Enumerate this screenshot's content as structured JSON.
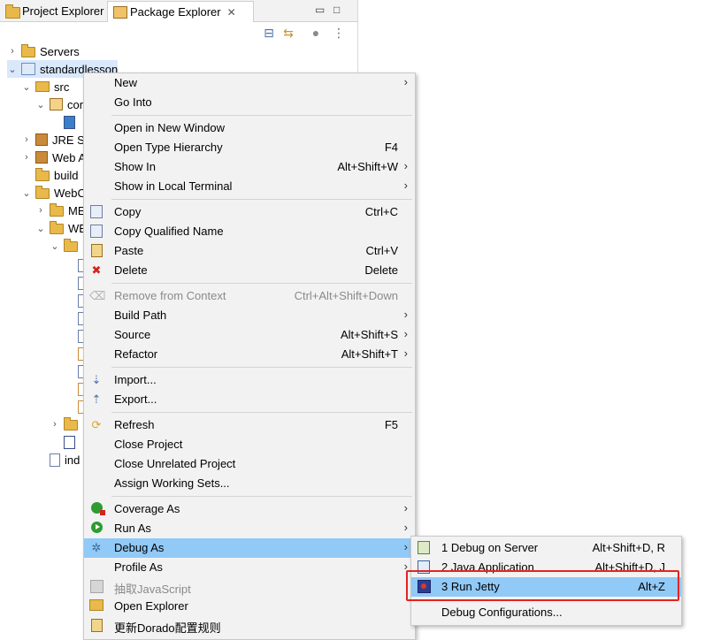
{
  "tabs": {
    "project_explorer": "Project Explorer",
    "package_explorer": "Package Explorer"
  },
  "tree": {
    "servers": "Servers",
    "project": "standardlesson",
    "src": "src",
    "com": "cor",
    "jre": "JRE Sy",
    "webapp": "Web A",
    "build": "build",
    "webcontent": "WebC",
    "meta": "ME",
    "webinf": "WE",
    "index": "ind"
  },
  "menu": {
    "items": [
      {
        "label": "New",
        "key": "",
        "arrow": true
      },
      {
        "label": "Go Into",
        "key": "",
        "arrow": false
      },
      {
        "label": "Open in New Window",
        "key": "",
        "arrow": false
      },
      {
        "label": "Open Type Hierarchy",
        "key": "F4",
        "arrow": false
      },
      {
        "label": "Show In",
        "key": "Alt+Shift+W",
        "arrow": true
      },
      {
        "label": "Show in Local Terminal",
        "key": "",
        "arrow": true
      },
      {
        "label": "Copy",
        "key": "Ctrl+C",
        "arrow": false
      },
      {
        "label": "Copy Qualified Name",
        "key": "",
        "arrow": false
      },
      {
        "label": "Paste",
        "key": "Ctrl+V",
        "arrow": false
      },
      {
        "label": "Delete",
        "key": "Delete",
        "arrow": false
      },
      {
        "label": "Remove from Context",
        "key": "Ctrl+Alt+Shift+Down",
        "arrow": false
      },
      {
        "label": "Build Path",
        "key": "",
        "arrow": true
      },
      {
        "label": "Source",
        "key": "Alt+Shift+S",
        "arrow": true
      },
      {
        "label": "Refactor",
        "key": "Alt+Shift+T",
        "arrow": true
      },
      {
        "label": "Import...",
        "key": "",
        "arrow": false
      },
      {
        "label": "Export...",
        "key": "",
        "arrow": false
      },
      {
        "label": "Refresh",
        "key": "F5",
        "arrow": false
      },
      {
        "label": "Close Project",
        "key": "",
        "arrow": false
      },
      {
        "label": "Close Unrelated Project",
        "key": "",
        "arrow": false
      },
      {
        "label": "Assign Working Sets...",
        "key": "",
        "arrow": false
      },
      {
        "label": "Coverage As",
        "key": "",
        "arrow": true
      },
      {
        "label": "Run As",
        "key": "",
        "arrow": true
      },
      {
        "label": "Debug As",
        "key": "",
        "arrow": true
      },
      {
        "label": "Profile As",
        "key": "",
        "arrow": true
      },
      {
        "label": "抽取JavaScript",
        "key": "",
        "arrow": false
      },
      {
        "label": "Open Explorer",
        "key": "",
        "arrow": false
      },
      {
        "label": "更新Dorado配置规则",
        "key": "",
        "arrow": false
      }
    ]
  },
  "submenu": {
    "items": [
      {
        "label": "1 Debug on Server",
        "key": "Alt+Shift+D, R"
      },
      {
        "label": "2 Java Application",
        "key": "Alt+Shift+D, J"
      },
      {
        "label": "3 Run Jetty",
        "key": "Alt+Z"
      },
      {
        "label": "Debug Configurations...",
        "key": ""
      }
    ]
  },
  "colors": {
    "highlight": "#91c9f7",
    "callout_border": "#e52222",
    "menu_bg": "#f2f2f2"
  }
}
